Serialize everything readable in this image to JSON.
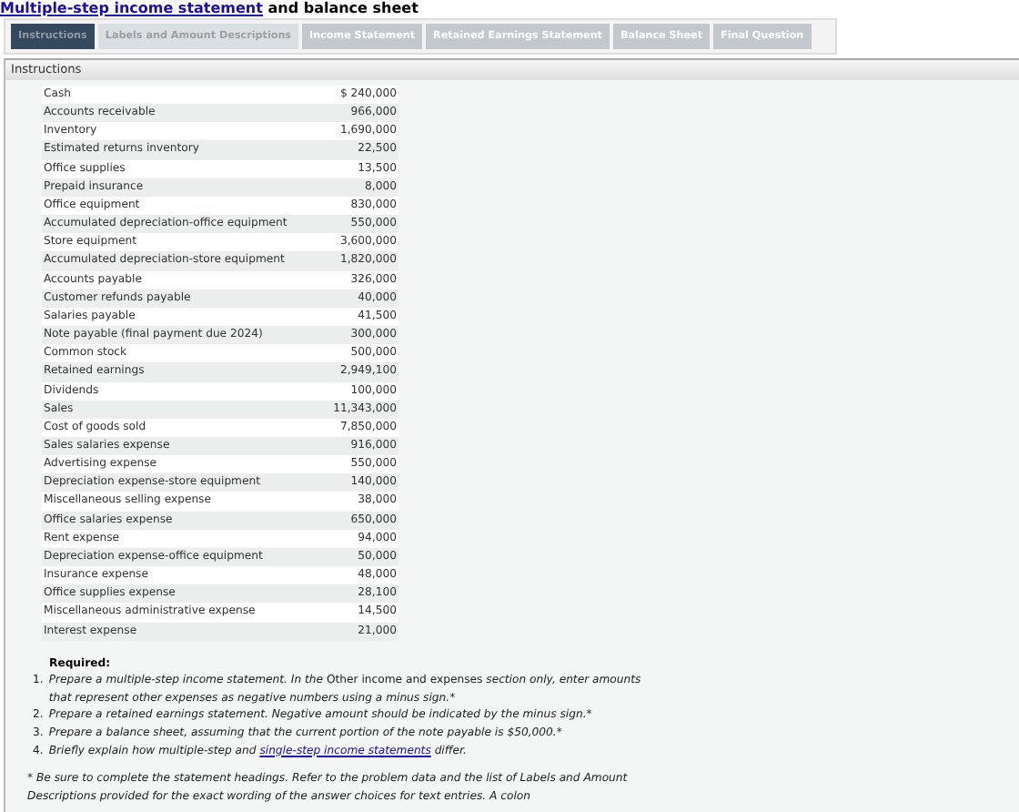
{
  "title": {
    "link": "Multiple-step income statement",
    "rest": "and balance sheet"
  },
  "tabs": [
    {
      "label": "Instructions",
      "selected": true,
      "disabled": false
    },
    {
      "label": "Labels and Amount Descriptions",
      "selected": false,
      "disabled": true
    },
    {
      "label": "Income Statement",
      "selected": false,
      "disabled": false
    },
    {
      "label": "Retained Earnings Statement",
      "selected": false,
      "disabled": false
    },
    {
      "label": "Balance Sheet",
      "selected": false,
      "disabled": false
    },
    {
      "label": "Final Question",
      "selected": false,
      "disabled": false
    }
  ],
  "panel": {
    "header": "Instructions",
    "accounts": [
      [
        "Cash",
        "$ 240,000"
      ],
      [
        "Accounts receivable",
        "966,000"
      ],
      [
        "Inventory",
        "1,690,000"
      ],
      [
        "Estimated returns inventory",
        "22,500"
      ],
      [
        "Office supplies",
        "13,500"
      ],
      [
        "Prepaid insurance",
        "8,000"
      ],
      [
        "Office equipment",
        "830,000"
      ],
      [
        "Accumulated depreciation-office equipment",
        "550,000"
      ],
      [
        "Store equipment",
        "3,600,000"
      ],
      [
        "Accumulated depreciation-store equipment",
        "1,820,000"
      ],
      [
        "Accounts payable",
        "326,000"
      ],
      [
        "Customer refunds payable",
        "40,000"
      ],
      [
        "Salaries payable",
        "41,500"
      ],
      [
        "Note payable (final payment due 2024)",
        "300,000"
      ],
      [
        "Common stock",
        "500,000"
      ],
      [
        "Retained earnings",
        "2,949,100"
      ],
      [
        "Dividends",
        "100,000"
      ],
      [
        "Sales",
        "11,343,000"
      ],
      [
        "Cost of goods sold",
        "7,850,000"
      ],
      [
        "Sales salaries expense",
        "916,000"
      ],
      [
        "Advertising expense",
        "550,000"
      ],
      [
        "Depreciation expense-store equipment",
        "140,000"
      ],
      [
        "Miscellaneous selling expense",
        "38,000"
      ],
      [
        "Office salaries expense",
        "650,000"
      ],
      [
        "Rent expense",
        "94,000"
      ],
      [
        "Depreciation expense-office equipment",
        "50,000"
      ],
      [
        "Insurance expense",
        "48,000"
      ],
      [
        "Office supplies expense",
        "28,100"
      ],
      [
        "Miscellaneous administrative expense",
        "14,500"
      ],
      [
        "Interest expense",
        "21,000"
      ]
    ],
    "required_heading": "Required:",
    "required": [
      {
        "marker": "1.",
        "text": "*Prepare a multiple-step income statement. In the* Other income and expenses *section only, enter amounts that represent other expenses as negative numbers using a minus sign.*",
        "note_mark": "*"
      },
      {
        "marker": "2.",
        "text": "*Prepare a retained earnings statement. Negative amount should be indicated by the minus sign.*",
        "note_mark": "*"
      },
      {
        "marker": "3.",
        "text": "*Prepare a balance sheet, assuming that the current portion of the note payable is $50,000.*",
        "note_mark": "*"
      },
      {
        "marker": "4.",
        "text": "*Briefly explain how multiple-step and*",
        "link": "single-step income statements",
        "after": "*differ.*"
      }
    ],
    "footnote": "* Be sure to complete the statement headings. Refer to the problem data and the list of Labels and Amount Descriptions provided for the exact wording of the answer choices for text entries. A colon"
  }
}
